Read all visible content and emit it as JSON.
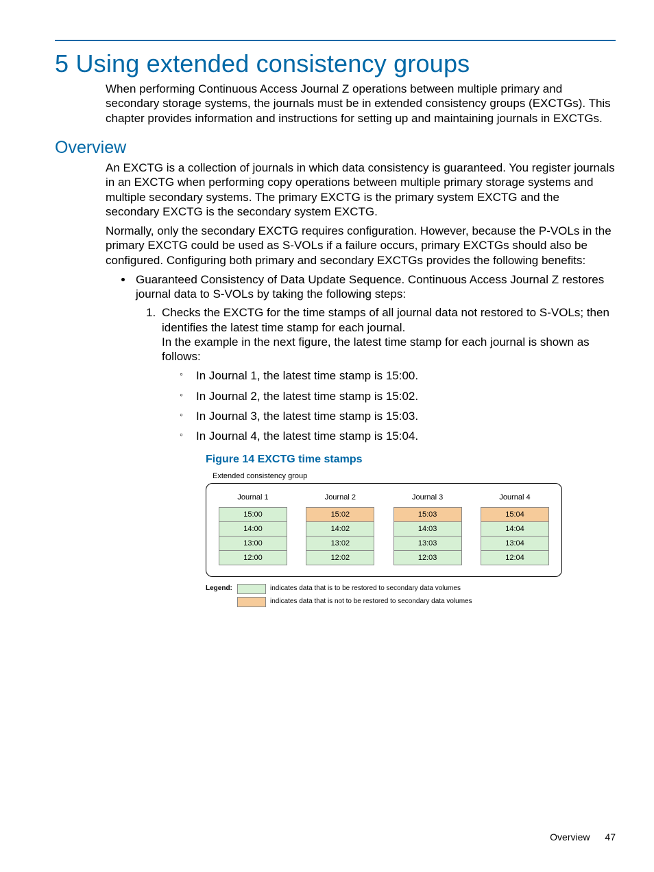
{
  "chapter": {
    "number": "5",
    "title": "Using extended consistency groups",
    "intro": "When performing Continuous Access Journal Z operations between multiple primary and secondary storage systems, the journals must be in extended consistency groups (EXCTGs). This chapter provides information and instructions for setting up and maintaining journals in EXCTGs."
  },
  "overview": {
    "heading": "Overview",
    "p1": "An EXCTG is a collection of journals in which data consistency is guaranteed. You register journals in an EXCTG when performing copy operations between multiple primary storage systems and multiple secondary systems. The primary EXCTG is the primary system EXCTG and the secondary EXCTG is the secondary system EXCTG.",
    "p2": "Normally, only the secondary EXCTG requires configuration. However, because the P-VOLs in the primary EXCTG could be used as S-VOLs if a failure occurs, primary EXCTGs should also be configured. Configuring both primary and secondary EXCTGs provides the following benefits:",
    "bullet1": "Guaranteed Consistency of Data Update Sequence. Continuous Access Journal Z restores journal data to S-VOLs by taking the following steps:",
    "step1": "Checks the EXCTG for the time stamps of all journal data not restored to S-VOLs; then identifies the latest time stamp for each journal.",
    "step1_p": "In the example in the next figure, the latest time stamp for each journal is shown as follows:",
    "subs": [
      "In Journal 1, the latest time stamp is 15:00.",
      "In Journal 2, the latest time stamp is 15:02.",
      "In Journal 3, the latest time stamp is 15:03.",
      "In Journal 4, the latest time stamp is 15:04."
    ]
  },
  "figure": {
    "caption": "Figure 14 EXCTG time stamps",
    "box_label": "Extended consistency group",
    "columns": [
      {
        "name": "Journal 1",
        "rows": [
          {
            "v": "15:00",
            "c": "green"
          },
          {
            "v": "14:00",
            "c": "green"
          },
          {
            "v": "13:00",
            "c": "green"
          },
          {
            "v": "12:00",
            "c": "green"
          }
        ]
      },
      {
        "name": "Journal 2",
        "rows": [
          {
            "v": "15:02",
            "c": "orange"
          },
          {
            "v": "14:02",
            "c": "green"
          },
          {
            "v": "13:02",
            "c": "green"
          },
          {
            "v": "12:02",
            "c": "green"
          }
        ]
      },
      {
        "name": "Journal 3",
        "rows": [
          {
            "v": "15:03",
            "c": "orange"
          },
          {
            "v": "14:03",
            "c": "green"
          },
          {
            "v": "13:03",
            "c": "green"
          },
          {
            "v": "12:03",
            "c": "green"
          }
        ]
      },
      {
        "name": "Journal 4",
        "rows": [
          {
            "v": "15:04",
            "c": "orange"
          },
          {
            "v": "14:04",
            "c": "green"
          },
          {
            "v": "13:04",
            "c": "green"
          },
          {
            "v": "12:04",
            "c": "green"
          }
        ]
      }
    ],
    "legend_label": "Legend:",
    "legend_green": "indicates data that is to be restored to secondary data volumes",
    "legend_orange": "indicates data that is not to be restored to secondary data volumes"
  },
  "footer": {
    "section": "Overview",
    "page": "47"
  },
  "chart_data": {
    "type": "table",
    "title": "EXCTG time stamps",
    "columns": [
      "Journal 1",
      "Journal 2",
      "Journal 3",
      "Journal 4"
    ],
    "rows": [
      [
        "15:00",
        "15:02",
        "15:03",
        "15:04"
      ],
      [
        "14:00",
        "14:02",
        "14:03",
        "14:04"
      ],
      [
        "13:00",
        "13:02",
        "13:03",
        "13:04"
      ],
      [
        "12:00",
        "12:02",
        "12:03",
        "12:04"
      ]
    ],
    "cell_status": [
      [
        "restore",
        "no-restore",
        "no-restore",
        "no-restore"
      ],
      [
        "restore",
        "restore",
        "restore",
        "restore"
      ],
      [
        "restore",
        "restore",
        "restore",
        "restore"
      ],
      [
        "restore",
        "restore",
        "restore",
        "restore"
      ]
    ],
    "legend": {
      "restore": "indicates data that is to be restored to secondary data volumes",
      "no-restore": "indicates data that is not to be restored to secondary data volumes"
    }
  }
}
